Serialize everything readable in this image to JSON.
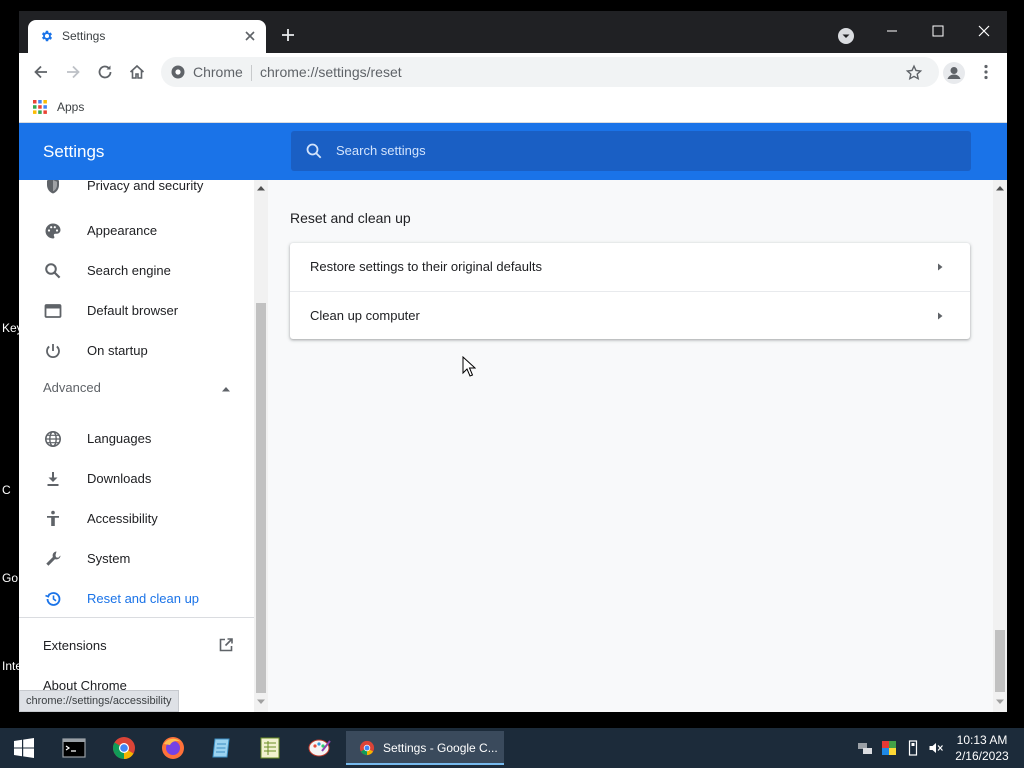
{
  "desktop": {
    "labels": [
      "Key",
      "C",
      "Go",
      "Inte"
    ]
  },
  "browser": {
    "tab_title": "Settings",
    "omnibox_chip": "Chrome",
    "url": "chrome://settings/reset",
    "bookmarks_apps": "Apps",
    "status_url": "chrome://settings/accessibility"
  },
  "settings": {
    "header_title": "Settings",
    "search_placeholder": "Search settings",
    "sidebar": {
      "items": [
        {
          "label": "Privacy and security",
          "icon": "shield-icon"
        },
        {
          "label": "Appearance",
          "icon": "palette-icon"
        },
        {
          "label": "Search engine",
          "icon": "search-icon"
        },
        {
          "label": "Default browser",
          "icon": "browser-icon"
        },
        {
          "label": "On startup",
          "icon": "power-icon"
        }
      ],
      "advanced_label": "Advanced",
      "advanced_items": [
        {
          "label": "Languages",
          "icon": "globe-icon"
        },
        {
          "label": "Downloads",
          "icon": "download-icon"
        },
        {
          "label": "Accessibility",
          "icon": "accessibility-icon"
        },
        {
          "label": "System",
          "icon": "wrench-icon"
        },
        {
          "label": "Reset and clean up",
          "icon": "history-icon",
          "active": true
        }
      ],
      "extensions_label": "Extensions",
      "about_label": "About Chrome"
    },
    "section_title": "Reset and clean up",
    "rows": [
      {
        "label": "Restore settings to their original defaults"
      },
      {
        "label": "Clean up computer"
      }
    ]
  },
  "taskbar": {
    "active_window": "Settings - Google C...",
    "time": "10:13 AM",
    "date": "2/16/2023"
  },
  "colors": {
    "accent": "#1a73e8",
    "header_bg": "#1a73e8",
    "titlebar": "#202124",
    "taskbar": "#1c2b3a"
  }
}
